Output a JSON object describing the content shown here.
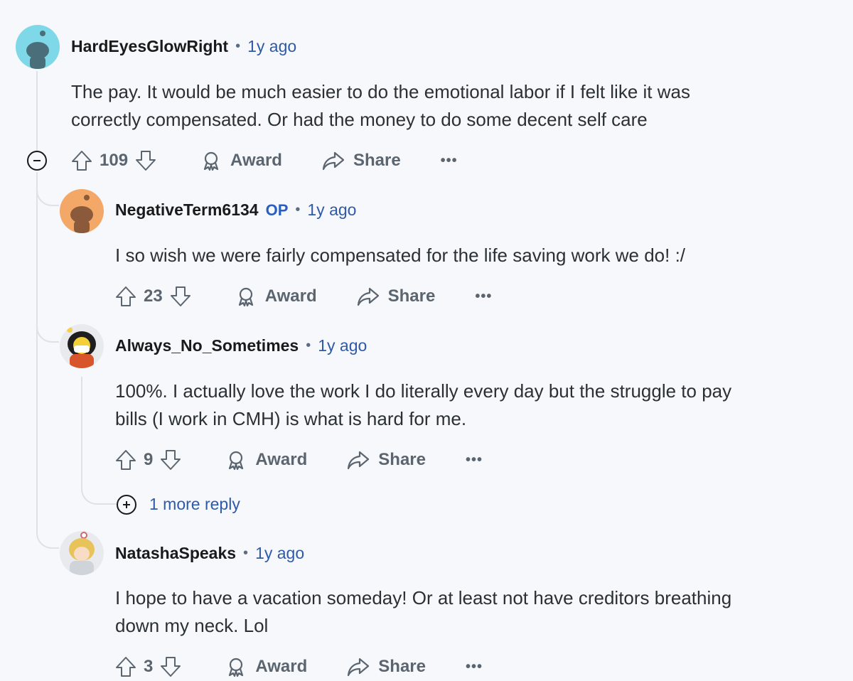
{
  "comments": [
    {
      "username": "HardEyesGlowRight",
      "time": "1y ago",
      "text_lines": [
        "The pay. It would be much easier to do the emotional labor if I felt like it was",
        "correctly compensated. Or had the money to do some decent self care"
      ],
      "votes": "109",
      "award_label": "Award",
      "share_label": "Share",
      "more_label": "•••"
    },
    {
      "username": "NegativeTerm6134",
      "op_badge": "OP",
      "time": "1y ago",
      "text_lines": [
        "I so wish we were fairly compensated for the life saving work we do! :/"
      ],
      "votes": "23",
      "award_label": "Award",
      "share_label": "Share",
      "more_label": "•••"
    },
    {
      "username": "Always_No_Sometimes",
      "time": "1y ago",
      "text_lines": [
        "100%. I actually love the work I do literally every day but the struggle to pay",
        "bills (I work in CMH) is what is hard for me."
      ],
      "votes": "9",
      "award_label": "Award",
      "share_label": "Share",
      "more_label": "•••",
      "more_replies": "1 more reply"
    },
    {
      "username": "NatashaSpeaks",
      "time": "1y ago",
      "text_lines": [
        "I hope to have a vacation someday! Or at least not have creditors breathing",
        "down my neck. Lol"
      ],
      "votes": "3",
      "award_label": "Award",
      "share_label": "Share",
      "more_label": "•••"
    }
  ],
  "colors": {
    "background": "#f7f8fb",
    "link": "#2f5aa8",
    "op": "#2a5fc2",
    "thread_line": "#dde2e8"
  },
  "icons": [
    "upvote-icon",
    "downvote-icon",
    "award-icon",
    "share-icon",
    "collapse-icon",
    "expand-icon"
  ]
}
